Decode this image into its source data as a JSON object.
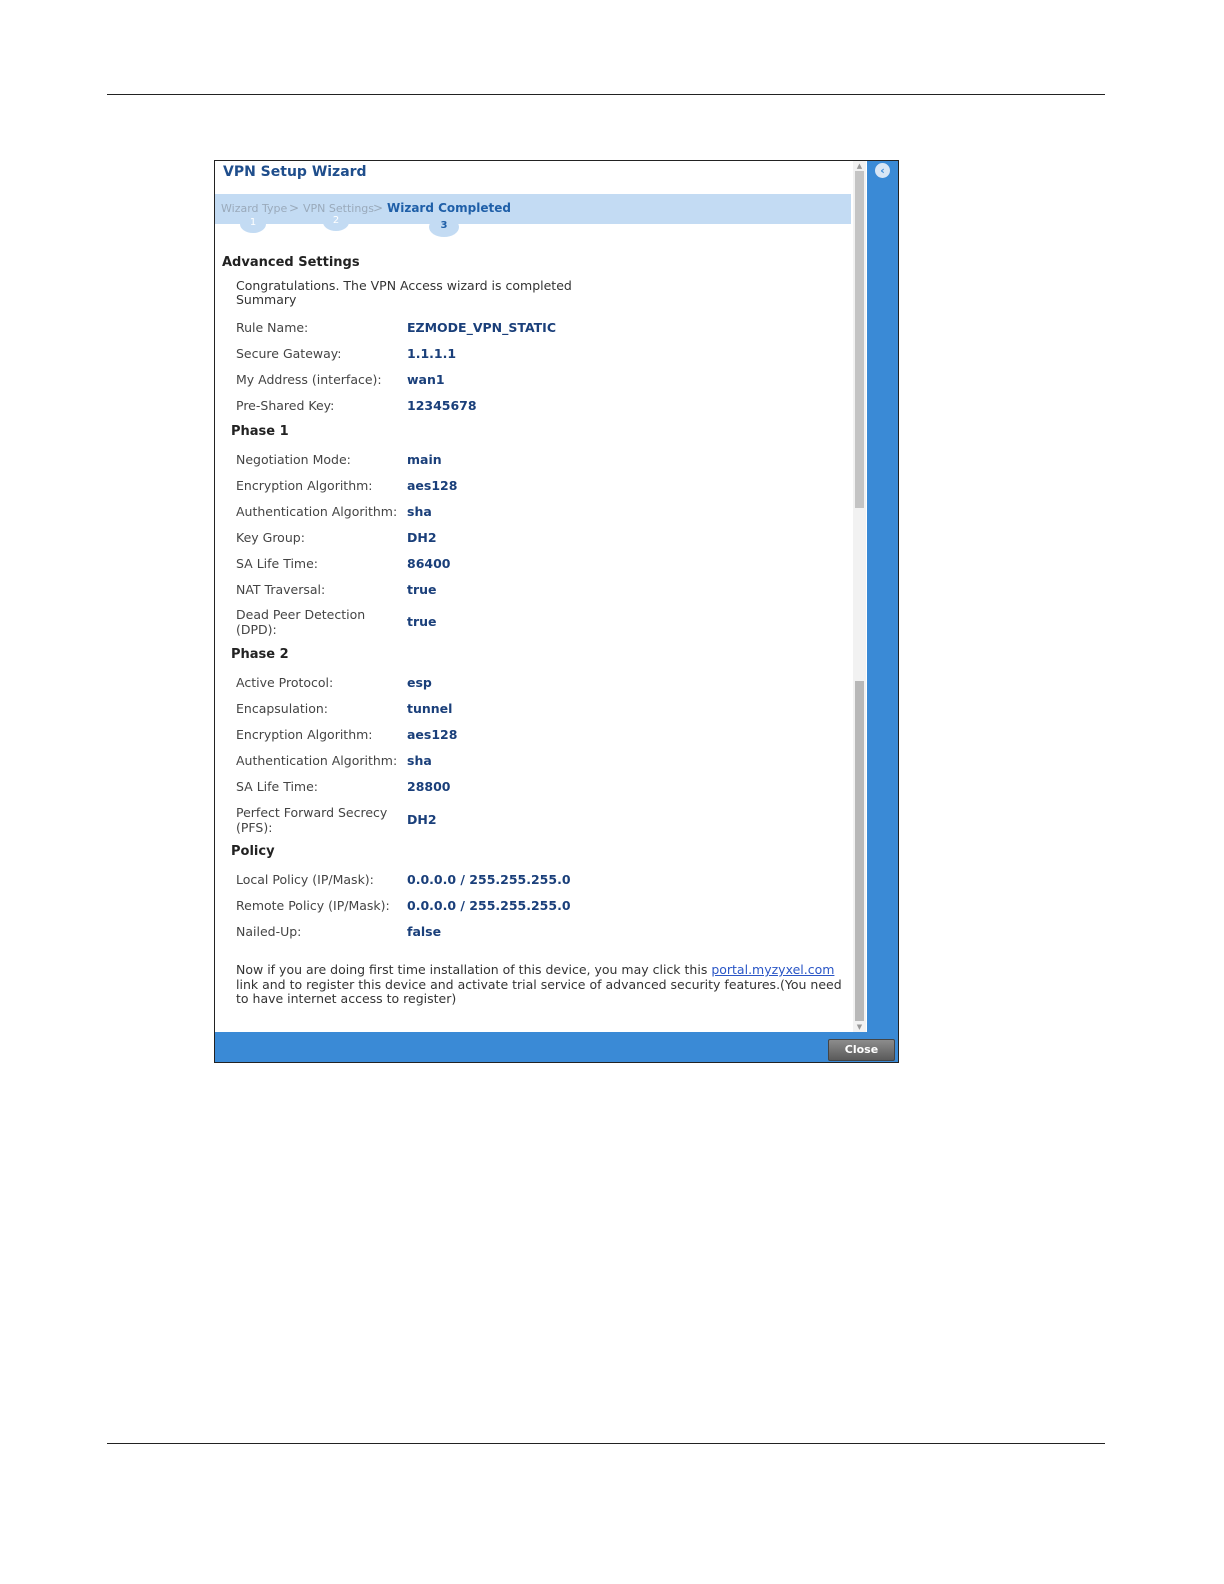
{
  "dialog": {
    "title": "VPN Setup Wizard",
    "close_label": "Close"
  },
  "steps": [
    {
      "label": "Wizard Type",
      "number": "1"
    },
    {
      "label": "VPN Settings",
      "number": "2"
    },
    {
      "label": "Wizard Completed",
      "number": "3"
    }
  ],
  "step_separator": ">",
  "advanced": {
    "title": "Advanced Settings",
    "congrats": "Congratulations. The VPN Access wizard is completed",
    "summary": "Summary"
  },
  "general_rows": [
    {
      "label": "Rule Name:",
      "value": "EZMODE_VPN_STATIC"
    },
    {
      "label": "Secure Gateway:",
      "value": "1.1.1.1"
    },
    {
      "label": "My Address (interface):",
      "value": "wan1"
    },
    {
      "label": "Pre-Shared Key:",
      "value": "12345678"
    }
  ],
  "phase1": {
    "title": "Phase 1",
    "rows": [
      {
        "label": "Negotiation Mode:",
        "value": "main"
      },
      {
        "label": "Encryption Algorithm:",
        "value": "aes128"
      },
      {
        "label": "Authentication Algorithm:",
        "value": "sha"
      },
      {
        "label": "Key Group:",
        "value": "DH2"
      },
      {
        "label": "SA Life Time:",
        "value": "86400"
      },
      {
        "label": "NAT Traversal:",
        "value": "true"
      },
      {
        "label_line1": "Dead Peer Detection",
        "label_line2": "(DPD):",
        "value": "true"
      }
    ]
  },
  "phase2": {
    "title": "Phase 2",
    "rows": [
      {
        "label": "Active Protocol:",
        "value": "esp"
      },
      {
        "label": "Encapsulation:",
        "value": "tunnel"
      },
      {
        "label": "Encryption Algorithm:",
        "value": "aes128"
      },
      {
        "label": "Authentication Algorithm:",
        "value": "sha"
      },
      {
        "label": "SA Life Time:",
        "value": "28800"
      },
      {
        "label_line1": "Perfect Forward Secrecy",
        "label_line2": "(PFS):",
        "value": "DH2"
      }
    ]
  },
  "policy": {
    "title": "Policy",
    "rows": [
      {
        "label": "Local Policy (IP/Mask):",
        "value": "0.0.0.0 / 255.255.255.0"
      },
      {
        "label": "Remote Policy (IP/Mask):",
        "value": "0.0.0.0 / 255.255.255.0"
      },
      {
        "label": "Nailed-Up:",
        "value": "false"
      }
    ]
  },
  "footer": {
    "text_before": "Now if you are doing first time installation of this device, you may click this ",
    "link_text": "portal.myzyxel.com",
    "text_after": " link and to register this device and activate trial service of advanced security features.(You need to have internet access to register)"
  },
  "icons": {
    "back": "chevron-left-icon",
    "scroll_up": "scroll-up-icon",
    "scroll_down": "scroll-down-icon"
  }
}
